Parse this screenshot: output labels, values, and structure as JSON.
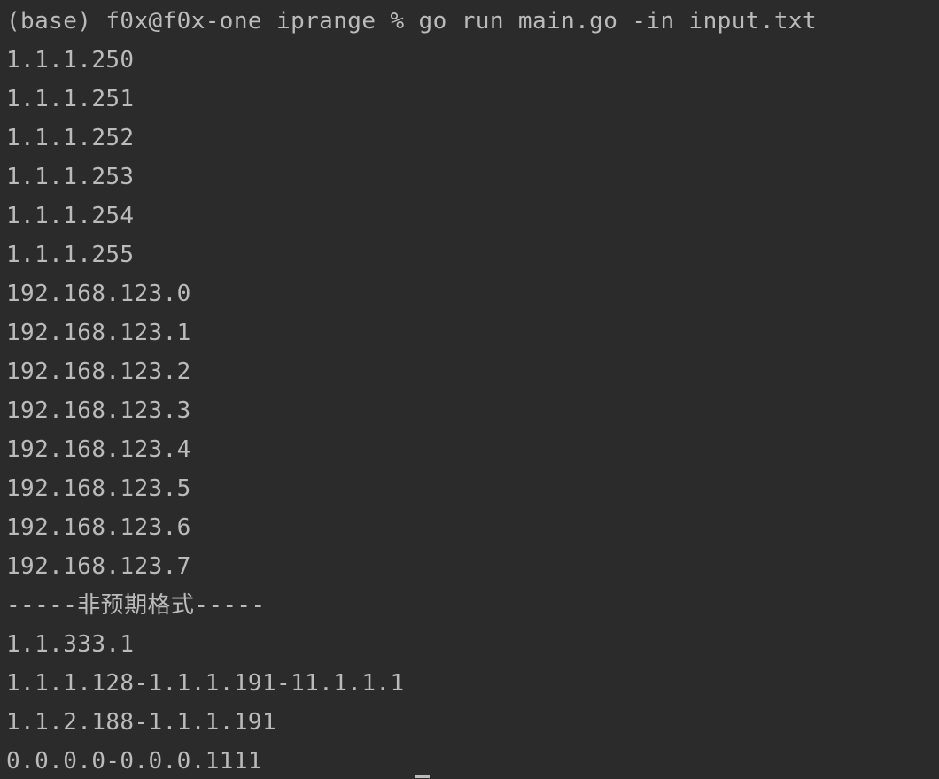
{
  "terminal": {
    "prompt_line": "(base) f0x@f0x-one iprange % go run main.go -in input.txt",
    "output_lines": [
      "1.1.1.250",
      "1.1.1.251",
      "1.1.1.252",
      "1.1.1.253",
      "1.1.1.254",
      "1.1.1.255",
      "192.168.123.0",
      "192.168.123.1",
      "192.168.123.2",
      "192.168.123.3",
      "192.168.123.4",
      "192.168.123.5",
      "192.168.123.6",
      "192.168.123.7",
      "-----非预期格式-----",
      "1.1.333.1",
      "1.1.1.128-1.1.1.191-11.1.1.1",
      "1.1.2.188-1.1.1.191",
      "0.0.0.0-0.0.0.1111"
    ],
    "colors": {
      "background": "#2b2b2b",
      "text": "#bbbbbb"
    }
  }
}
